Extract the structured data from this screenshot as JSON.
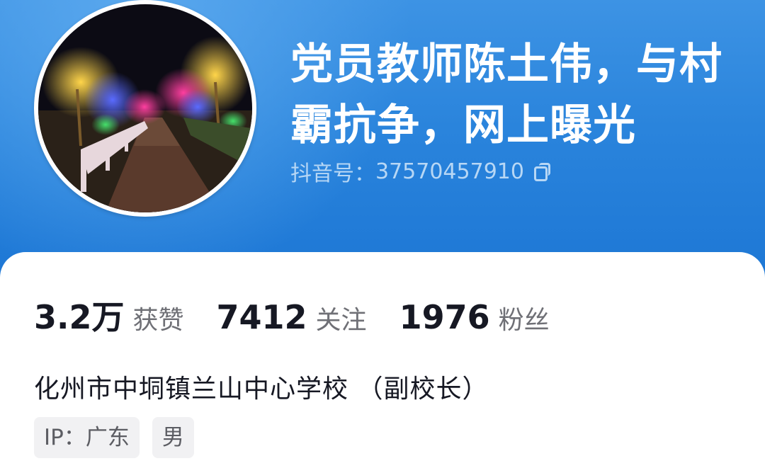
{
  "profile": {
    "title": "党员教师陈土伟，与村霸抗争，网上曝光",
    "account_label": "抖音号：",
    "account_id": "37570457910",
    "avatar_description_icon": "avatar-photo",
    "stats": [
      {
        "value": "3.2万",
        "label": "获赞"
      },
      {
        "value": "7412",
        "label": "关注"
      },
      {
        "value": "1976",
        "label": "粉丝"
      }
    ],
    "bio": "化州市中垌镇兰山中心学校 （副校长）",
    "tags": [
      "IP：广东",
      "男"
    ]
  },
  "colors": {
    "header_blue": "#2a84dc",
    "text_dark": "#161823",
    "text_gray": "#6f7076"
  }
}
